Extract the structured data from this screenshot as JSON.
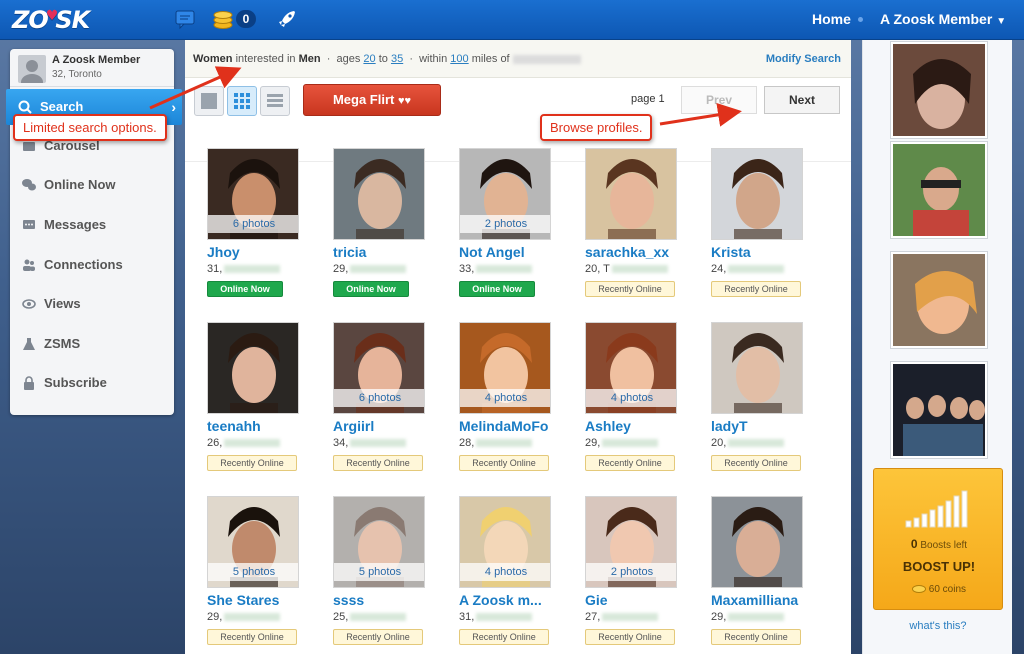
{
  "topbar": {
    "logo": "ZOOSK",
    "coins_count": "0",
    "nav_home": "Home",
    "nav_member": "A Zoosk Member"
  },
  "sidebar": {
    "profile_name": "A Zoosk Member",
    "profile_location": "32, Toronto",
    "items": [
      {
        "label": "Search",
        "icon": "search-icon",
        "active": true
      },
      {
        "label": "Carousel",
        "icon": "carousel-icon"
      },
      {
        "label": "Online Now",
        "icon": "chat-bubbles-icon"
      },
      {
        "label": "Messages",
        "icon": "message-icon"
      },
      {
        "label": "Connections",
        "icon": "connections-icon"
      },
      {
        "label": "Views",
        "icon": "eye-icon"
      },
      {
        "label": "ZSMS",
        "icon": "flask-icon"
      },
      {
        "label": "Subscribe",
        "icon": "lock-icon"
      }
    ]
  },
  "filter": {
    "gender": "Women",
    "interested_in": "interested in",
    "seeking": "Men",
    "ages_label": "ages",
    "age_min": "20",
    "to": "to",
    "age_max": "35",
    "within": "within",
    "distance": "100",
    "miles_of": "miles of",
    "modify": "Modify Search"
  },
  "toolbar": {
    "mega_flirt": "Mega Flirt",
    "page_label": "page 1",
    "prev": "Prev",
    "next": "Next"
  },
  "profiles": [
    {
      "name": "Jhoy",
      "age": "31,",
      "photos": "6 photos",
      "status": "Online Now",
      "status_type": "online"
    },
    {
      "name": "tricia",
      "age": "29,",
      "photos": "",
      "status": "Online Now",
      "status_type": "online"
    },
    {
      "name": "Not Angel",
      "age": "33,",
      "photos": "2 photos",
      "status": "Online Now",
      "status_type": "online"
    },
    {
      "name": "sarachka_xx",
      "age": "20, T",
      "photos": "",
      "status": "Recently Online",
      "status_type": "recent"
    },
    {
      "name": "Krista",
      "age": "24,",
      "photos": "",
      "status": "Recently Online",
      "status_type": "recent"
    },
    {
      "name": "teenahh",
      "age": "26,",
      "photos": "",
      "status": "Recently Online",
      "status_type": "recent"
    },
    {
      "name": "Argiirl",
      "age": "34,",
      "photos": "6 photos",
      "status": "Recently Online",
      "status_type": "recent"
    },
    {
      "name": "MelindaMoFo",
      "age": "28,",
      "photos": "4 photos",
      "status": "Recently Online",
      "status_type": "recent"
    },
    {
      "name": "Ashley",
      "age": "29,",
      "photos": "4 photos",
      "status": "Recently Online",
      "status_type": "recent"
    },
    {
      "name": "ladyT",
      "age": "20,",
      "photos": "",
      "status": "Recently Online",
      "status_type": "recent"
    },
    {
      "name": "She Stares",
      "age": "29,",
      "photos": "5 photos",
      "status": "Recently Online",
      "status_type": "recent"
    },
    {
      "name": "ssss",
      "age": "25,",
      "photos": "5 photos",
      "status": "Recently Online",
      "status_type": "recent"
    },
    {
      "name": "A Zoosk m...",
      "age": "31,",
      "photos": "4 photos",
      "status": "Recently Online",
      "status_type": "recent"
    },
    {
      "name": "Gie",
      "age": "27,",
      "photos": "2 photos",
      "status": "Recently Online",
      "status_type": "recent"
    },
    {
      "name": "Maxamilliana",
      "age": "29,",
      "photos": "",
      "status": "Recently Online",
      "status_type": "recent"
    }
  ],
  "boost": {
    "count": "0",
    "count_label": "Boosts left",
    "title": "BOOST UP!",
    "coins": "60 coins",
    "whats_this": "what's this?"
  },
  "annotations": {
    "search_note": "Limited search options.",
    "browse_note": "Browse profiles."
  },
  "colors": {
    "topbar": "#0d57b3",
    "link": "#1a7cc4",
    "online": "#1fa84d",
    "mega_flirt": "#d6432b",
    "boost": "#f5a819",
    "annotation": "#e0311b"
  }
}
